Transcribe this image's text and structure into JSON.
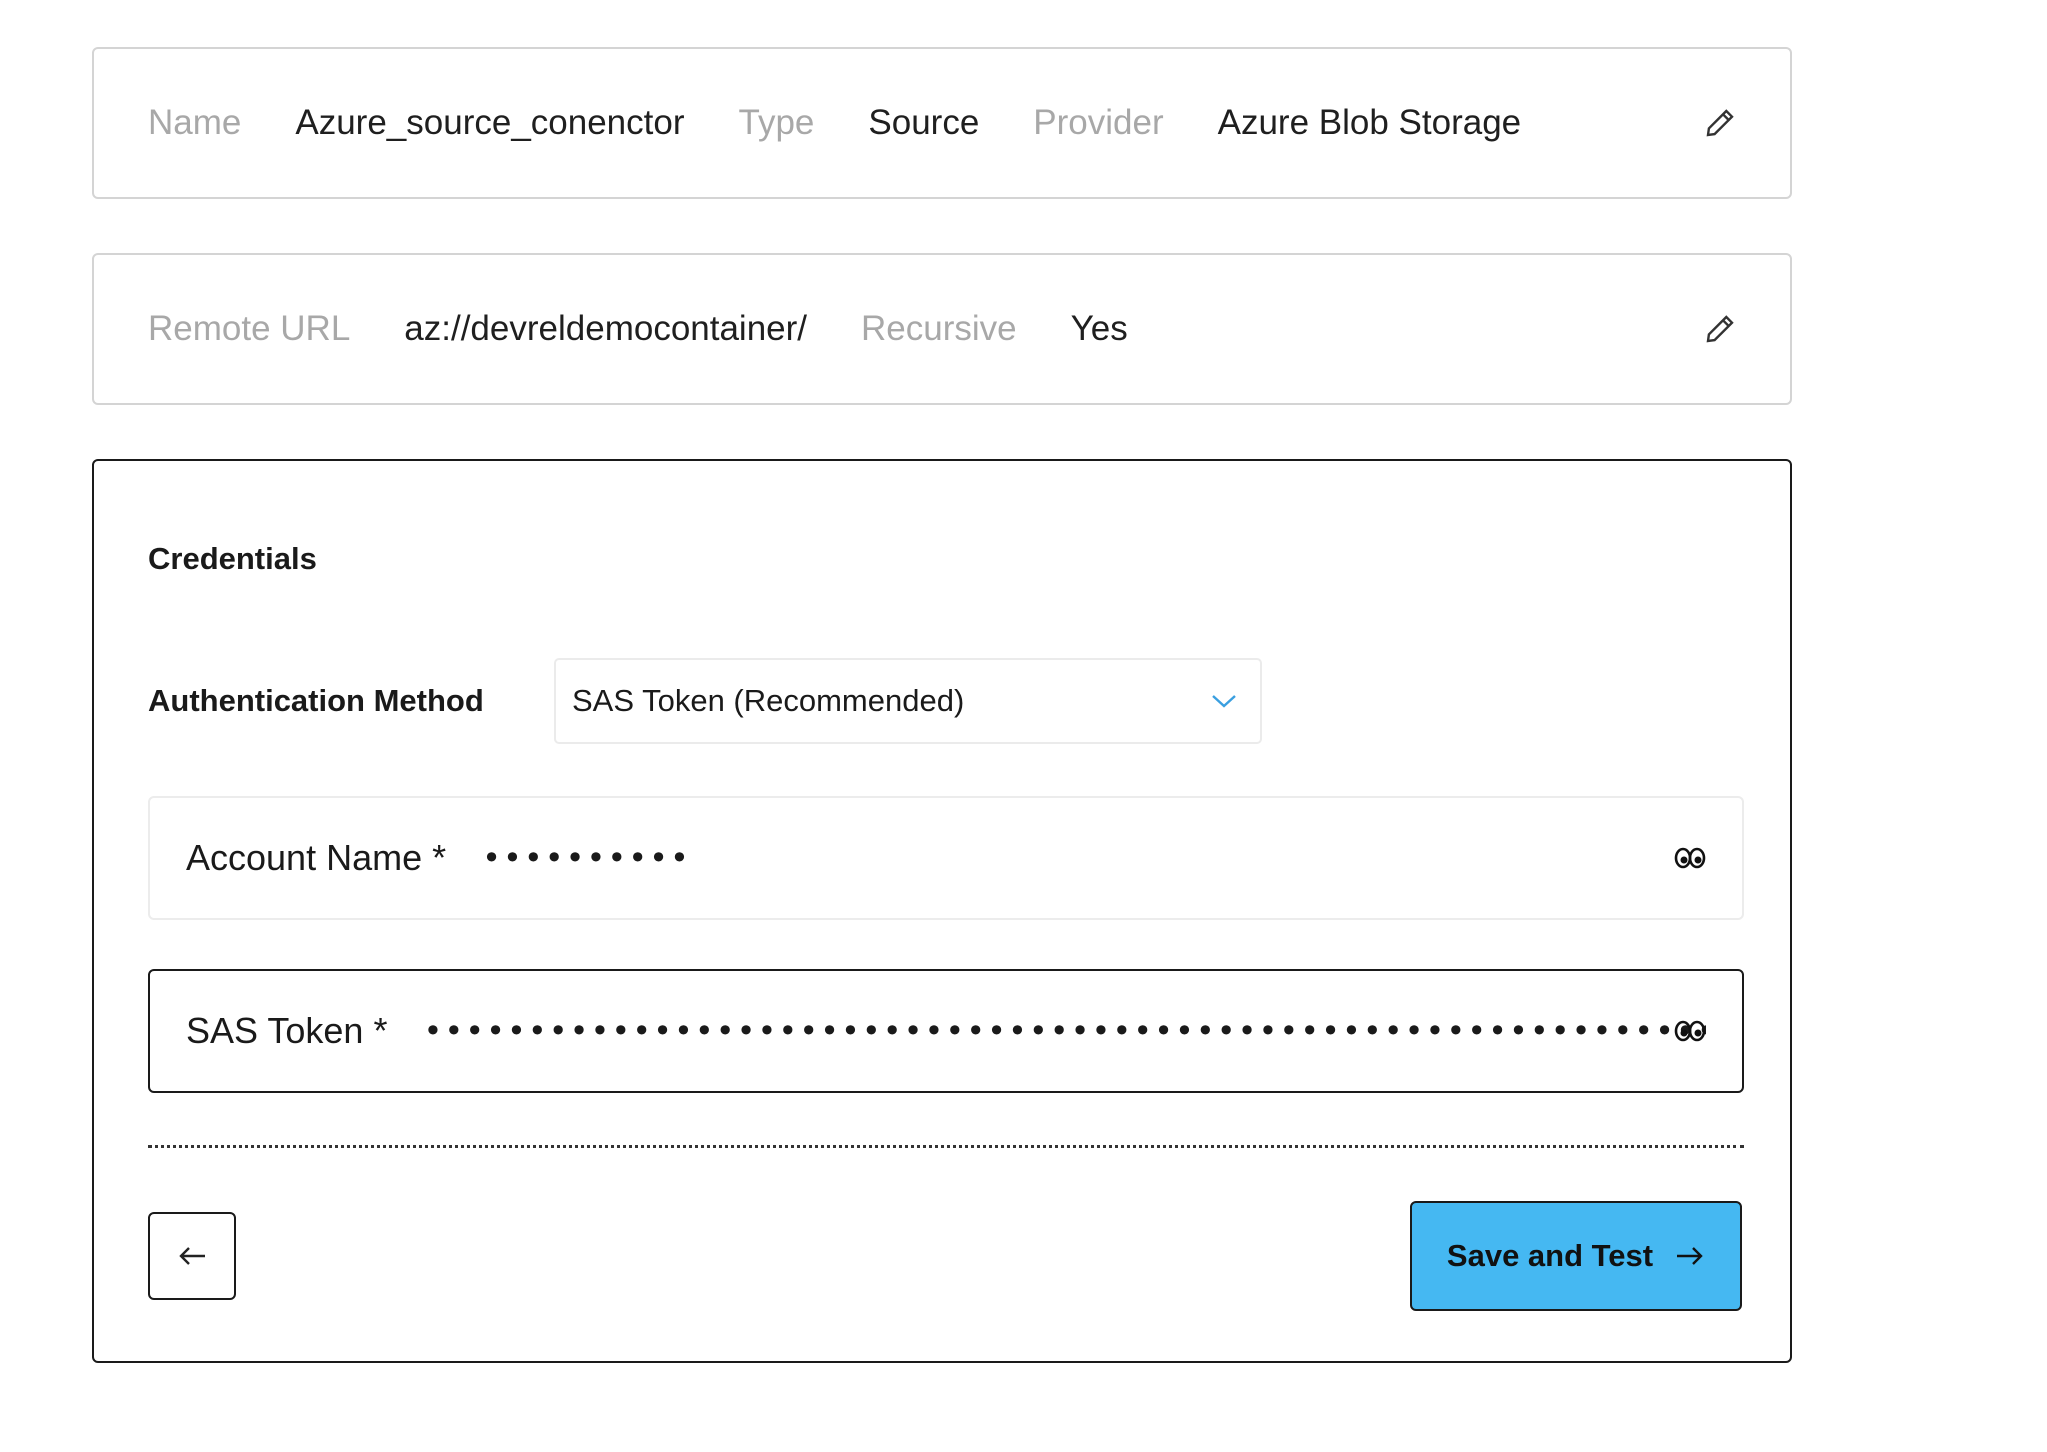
{
  "summary": {
    "name_label": "Name",
    "name_value": "Azure_source_conenctor",
    "type_label": "Type",
    "type_value": "Source",
    "provider_label": "Provider",
    "provider_value": "Azure Blob Storage",
    "edit_icon": "pencil-icon"
  },
  "location": {
    "url_label": "Remote URL",
    "url_value": "az://devreldemocontainer/",
    "recursive_label": "Recursive",
    "recursive_value": "Yes",
    "edit_icon": "pencil-icon"
  },
  "credentials": {
    "title": "Credentials",
    "auth_label": "Authentication Method",
    "auth_selected": "SAS Token (Recommended)",
    "account_label": "Account Name *",
    "account_mask": "••••••••••",
    "sas_label": "SAS Token *",
    "sas_mask": "••••••••••••••••••••••••••••••••••••••••••••••••••••••••••••••••••••••••••••••••••",
    "reveal_icon": "eye-icon"
  },
  "actions": {
    "back_icon": "arrow-left-icon",
    "save_label": "Save and Test",
    "save_icon": "arrow-right-icon"
  },
  "colors": {
    "accent": "#45b8f2",
    "muted_label": "#a8a8a8",
    "chevron": "#3a9fe0"
  }
}
